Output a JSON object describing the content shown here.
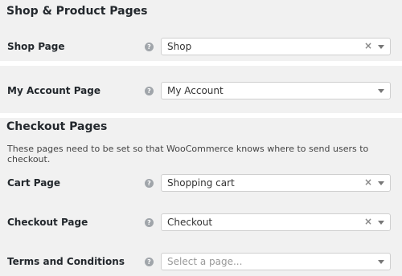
{
  "shop_section": {
    "title": "Shop & Product Pages",
    "shop_page": {
      "label": "Shop Page",
      "value": "Shop"
    }
  },
  "account": {
    "label": "My Account Page",
    "value": "My Account"
  },
  "checkout_section": {
    "title": "Checkout Pages",
    "description": "These pages need to be set so that WooCommerce knows where to send users to checkout.",
    "cart_page": {
      "label": "Cart Page",
      "value": "Shopping cart"
    },
    "checkout_page": {
      "label": "Checkout Page",
      "value": "Checkout"
    },
    "terms_page": {
      "label": "Terms and Conditions",
      "placeholder": "Select a page..."
    }
  },
  "icons": {
    "help": "?",
    "clear": "×"
  }
}
